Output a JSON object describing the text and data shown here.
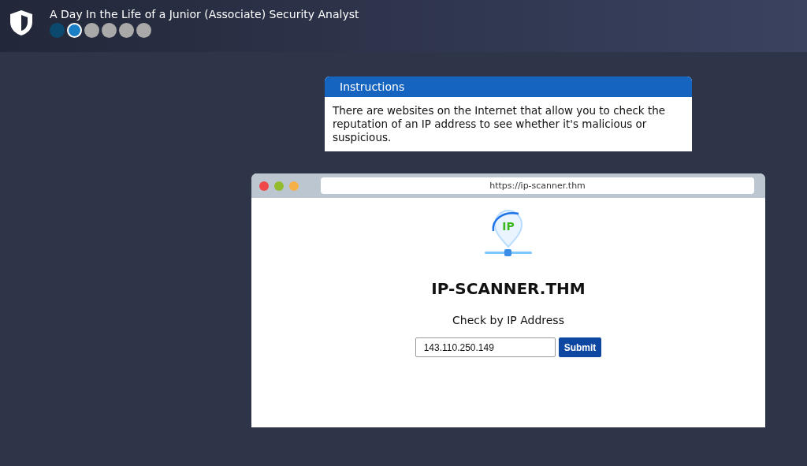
{
  "header": {
    "title": "A Day In the Life of a Junior (Associate) Security Analyst",
    "steps": [
      {
        "completed": true,
        "selected": false
      },
      {
        "completed": false,
        "selected": true
      },
      {
        "completed": false,
        "selected": false
      },
      {
        "completed": false,
        "selected": false
      },
      {
        "completed": false,
        "selected": false
      },
      {
        "completed": false,
        "selected": false
      }
    ]
  },
  "instructions": {
    "title": "Instructions",
    "text": "There are websites on the Internet that allow you to check the reputation of an IP address to see whether it's malicious or suspicious."
  },
  "browser": {
    "url": "https://ip-scanner.thm",
    "logo_text": "IP",
    "site_title": "IP-SCANNER.THM",
    "form_label": "Check by IP Address",
    "ip_value": "143.110.250.149",
    "submit": "Submit"
  }
}
